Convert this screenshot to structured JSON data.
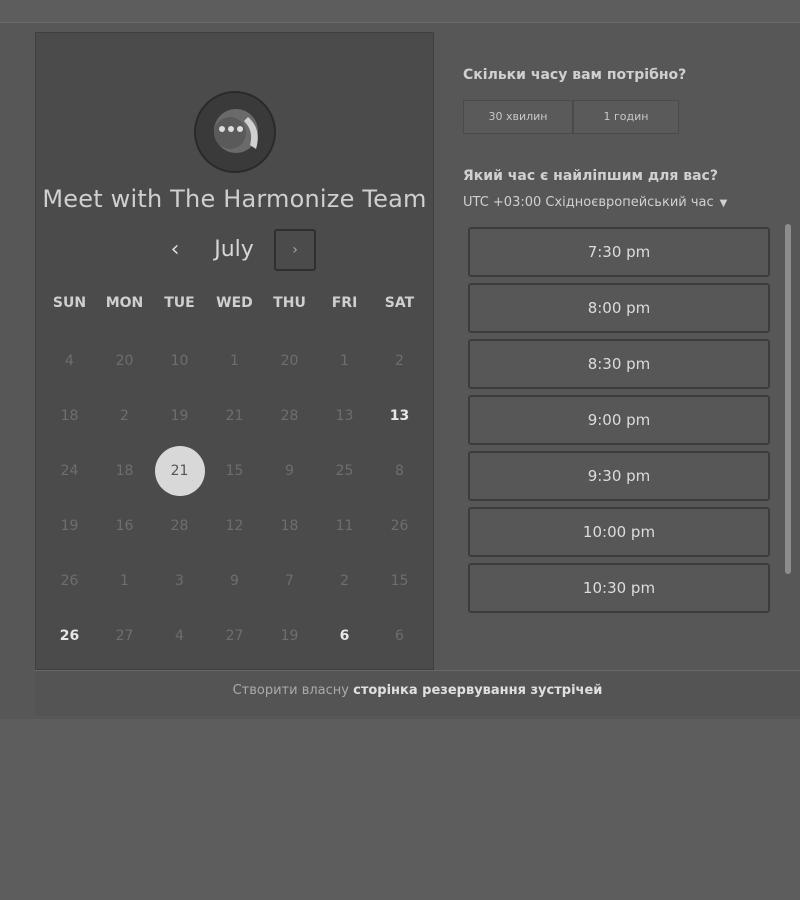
{
  "calendar": {
    "title": "Meet with The Harmonize Team",
    "month": "July",
    "prev_icon": "‹",
    "next_icon": "›",
    "weekdays": [
      "SUN",
      "MON",
      "TUE",
      "WED",
      "THU",
      "FRI",
      "SAT"
    ],
    "weeks": [
      [
        "4",
        "20",
        "10",
        "1",
        "20",
        "1",
        "2"
      ],
      [
        "18",
        "2",
        "19",
        "21",
        "28",
        "13",
        "13"
      ],
      [
        "24",
        "18",
        "21",
        "15",
        "9",
        "25",
        "8"
      ],
      [
        "19",
        "16",
        "28",
        "12",
        "18",
        "11",
        "26"
      ],
      [
        "26",
        "1",
        "3",
        "9",
        "7",
        "2",
        "15"
      ],
      [
        "26",
        "27",
        "4",
        "27",
        "19",
        "6",
        "6"
      ]
    ]
  },
  "duration": {
    "question": "Скільки часу вам потрібно?",
    "options": [
      "30 хвилин",
      "1 годин"
    ]
  },
  "time": {
    "question": "Який час є найліпшим для вас?",
    "timezone": "UTC +03:00 Східноєвропейський час",
    "slots": [
      "7:30 pm",
      "8:00 pm",
      "8:30 pm",
      "9:00 pm",
      "9:30 pm",
      "10:00 pm",
      "10:30 pm"
    ]
  },
  "footer": {
    "prefix": "Створити власну ",
    "link": "сторінка резервування зустрічей"
  }
}
